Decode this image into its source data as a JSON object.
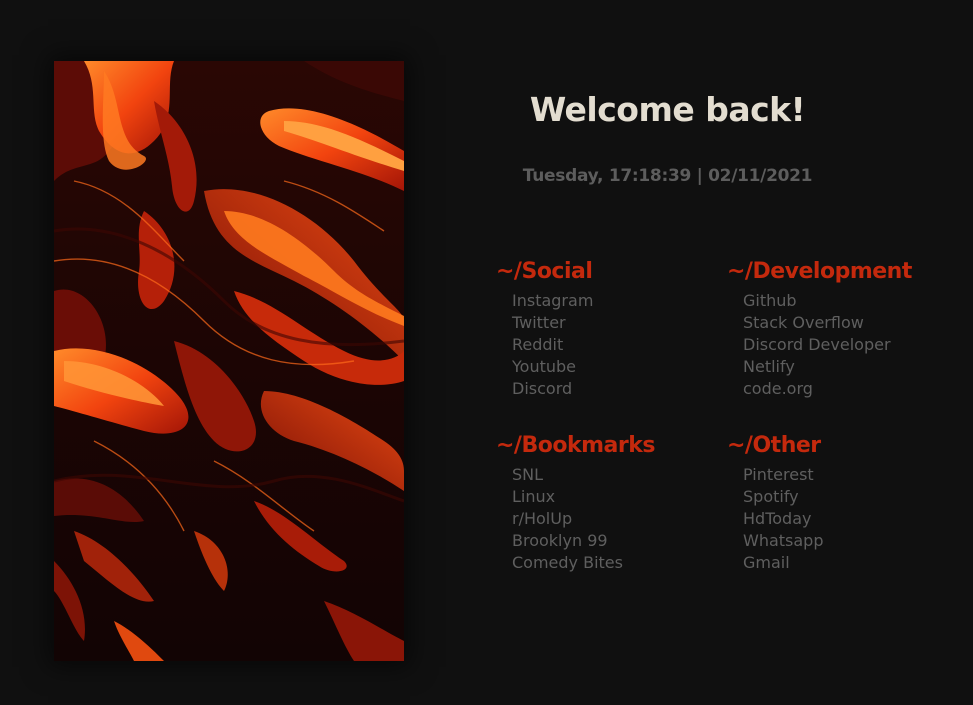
{
  "header": {
    "greeting": "Welcome back!",
    "datetime": "Tuesday, 17:18:39 | 02/11/2021"
  },
  "colors": {
    "background": "#101010",
    "accent": "#c4290d",
    "heading_text": "#e3ddd0",
    "link_text": "#5f5f5f",
    "clock_text": "#5d5d5d"
  },
  "image": {
    "description_icon": "red-lava-fluid-art"
  },
  "groups": [
    {
      "title": "~/Social",
      "links": [
        "Instagram",
        "Twitter",
        "Reddit",
        "Youtube",
        "Discord"
      ]
    },
    {
      "title": "~/Development",
      "links": [
        "Github",
        "Stack Overflow",
        "Discord Developer",
        "Netlify",
        "code.org"
      ]
    },
    {
      "title": "~/Bookmarks",
      "links": [
        "SNL",
        "Linux",
        "r/HolUp",
        "Brooklyn 99",
        "Comedy Bites"
      ]
    },
    {
      "title": "~/Other",
      "links": [
        "Pinterest",
        "Spotify",
        "HdToday",
        "Whatsapp",
        "Gmail"
      ]
    }
  ]
}
